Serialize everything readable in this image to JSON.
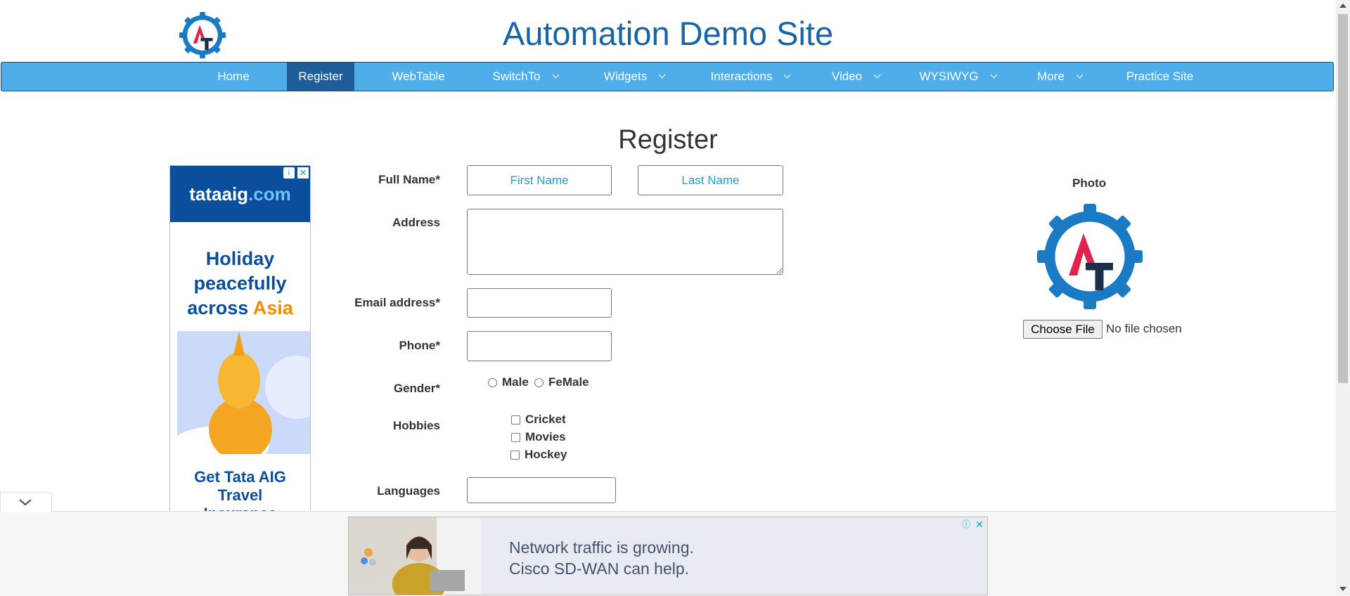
{
  "header": {
    "title": "Automation Demo Site",
    "logo_text": "AT"
  },
  "nav": {
    "items": [
      {
        "label": "Home"
      },
      {
        "label": "Register"
      },
      {
        "label": "WebTable"
      },
      {
        "label": "SwitchTo"
      },
      {
        "label": "Widgets"
      },
      {
        "label": "Interactions"
      },
      {
        "label": "Video"
      },
      {
        "label": "WYSIWYG"
      },
      {
        "label": "More"
      },
      {
        "label": "Practice Site"
      }
    ],
    "active": "Register"
  },
  "page": {
    "title": "Register"
  },
  "form": {
    "full_name_label": "Full Name*",
    "first_name_placeholder": "First Name",
    "last_name_placeholder": "Last Name",
    "address_label": "Address",
    "email_label": "Email address*",
    "phone_label": "Phone*",
    "gender_label": "Gender*",
    "gender_options": [
      "Male",
      "FeMale"
    ],
    "hobbies_label": "Hobbies",
    "hobbies": [
      "Cricket",
      "Movies",
      "Hockey"
    ],
    "languages_label": "Languages"
  },
  "photo": {
    "label": "Photo",
    "button": "Choose File",
    "status": "No file chosen"
  },
  "ad_left": {
    "brand": "tataaig",
    "brand_suffix": ".com",
    "line1": "Holiday",
    "line2": "peacefully",
    "line3": "across ",
    "line3_accent": "Asia",
    "cta1": "Get Tata AIG",
    "cta2": "Travel",
    "cta3": "Insurance"
  },
  "ad_bottom": {
    "line1": "Network traffic is growing.",
    "line2": "Cisco SD-WAN can help."
  },
  "colors": {
    "nav_bg": "#4fadea",
    "nav_active": "#1f5d99",
    "title": "#1565a7",
    "placeholder": "#1a9ed9"
  }
}
